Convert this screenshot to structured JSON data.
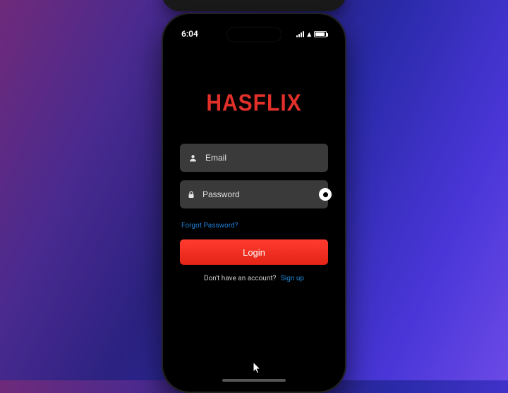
{
  "status": {
    "time": "6:04"
  },
  "brand": {
    "name": "HASFLIX",
    "color": "#e12f2a"
  },
  "form": {
    "email": {
      "placeholder": "Email",
      "value": ""
    },
    "password": {
      "placeholder": "Password",
      "value": ""
    },
    "forgot_label": "Forgot Password?",
    "login_label": "Login",
    "signup_prompt": "Don't have an account?",
    "signup_link": "Sign up"
  },
  "colors": {
    "accent_red": "#e32417",
    "link_blue": "#1f89d6",
    "field_bg": "#3a3a3a"
  }
}
